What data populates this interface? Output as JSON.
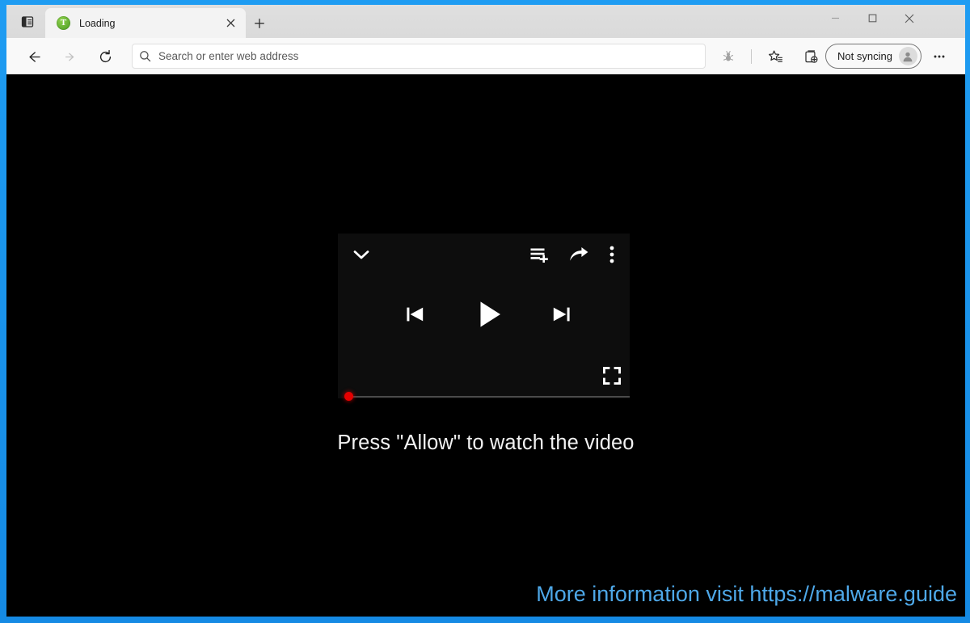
{
  "window": {
    "frame_color": "#1a9bf0",
    "controls": {
      "minimize": {
        "name": "minimize",
        "glyph": "—"
      },
      "maximize": {
        "name": "maximize",
        "glyph": "□"
      },
      "close": {
        "name": "close",
        "glyph": "✕"
      }
    }
  },
  "tabstrip": {
    "vertical_tabs_icon": "vertical-tabs-icon",
    "tabs": [
      {
        "title": "Loading",
        "favicon_icon": "green-circle-t-favicon",
        "favicon_letter": "T",
        "favicon_color": "#5aa82b",
        "close_glyph": "✕",
        "active": true
      }
    ],
    "new_tab_glyph": "+",
    "new_tab_name": "new-tab-button"
  },
  "toolbar": {
    "back_icon": "back-arrow-icon",
    "back_glyph": "←",
    "forward_icon": "forward-arrow-icon",
    "forward_glyph": "→",
    "reload_icon": "reload-icon",
    "tracker_icon": "tracking-prevention-icon",
    "favorites_icon": "favorites-star-icon",
    "collections_icon": "collections-icon",
    "more_icon": "more-settings-icon",
    "more_glyph": "⋯",
    "sync": {
      "label": "Not syncing",
      "avatar_icon": "profile-avatar-icon"
    }
  },
  "omnibox": {
    "search_icon": "search-icon",
    "value": "",
    "placeholder": "Search or enter web address"
  },
  "page": {
    "background": "#000000",
    "player": {
      "background": "#0d0d0d",
      "collapse_icon": "chevron-down-icon",
      "queue_icon": "add-to-queue-icon",
      "share_icon": "share-arrow-icon",
      "menu_icon": "overflow-menu-icon",
      "previous_icon": "previous-track-icon",
      "play_icon": "play-icon",
      "next_icon": "next-track-icon",
      "fullscreen_icon": "fullscreen-icon",
      "progress": {
        "percent": 0,
        "thumb_color": "#e60000",
        "track_color": "#4a4a4a"
      }
    },
    "allow_prompt": "Press \"Allow\" to watch the video",
    "watermark": {
      "text": "More information visit https://malware.guide",
      "color": "#4ea8e8"
    }
  }
}
